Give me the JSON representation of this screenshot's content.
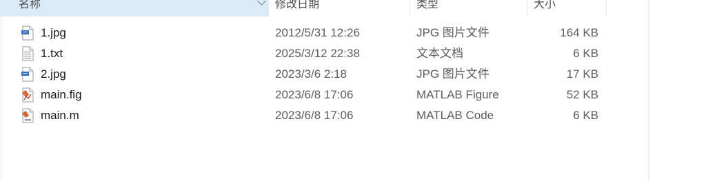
{
  "header": {
    "name": "名称",
    "modified": "修改日期",
    "type": "类型",
    "size": "大小"
  },
  "files": [
    {
      "name": "1.jpg",
      "modified": "2012/5/31 12:26",
      "type": "JPG 图片文件",
      "size": "164 KB",
      "icon": "jpg-file-icon"
    },
    {
      "name": "1.txt",
      "modified": "2025/3/12 22:38",
      "type": "文本文档",
      "size": "6 KB",
      "icon": "text-file-icon"
    },
    {
      "name": "2.jpg",
      "modified": "2023/3/6 2:18",
      "type": "JPG 图片文件",
      "size": "17 KB",
      "icon": "jpg-file-icon"
    },
    {
      "name": "main.fig",
      "modified": "2023/6/8 17:06",
      "type": "MATLAB Figure",
      "size": "52 KB",
      "icon": "matlab-figure-icon"
    },
    {
      "name": "main.m",
      "modified": "2023/6/8 17:06",
      "type": "MATLAB Code",
      "size": "6 KB",
      "icon": "matlab-code-icon"
    }
  ],
  "colors": {
    "sorted_header_bg": "#d9ebf9",
    "jpg_badge": "#2f6fc0",
    "matlab_orange": "#d9642a"
  }
}
